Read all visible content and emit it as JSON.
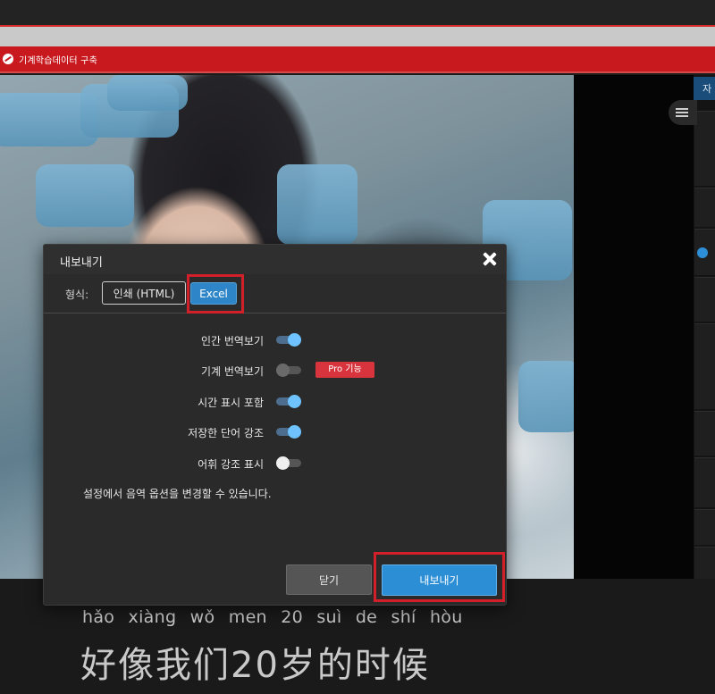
{
  "notice": {
    "text": "기계학습데이터 구축"
  },
  "side": {
    "tab_label": "자"
  },
  "subtitle": {
    "pinyin": "hǎo xiàng wǒ men 20 suì de shí hòu",
    "hanzi": "好像我们20岁的时候"
  },
  "dialog": {
    "title": "내보내기",
    "format_label": "형식:",
    "formats": [
      {
        "label": "인쇄 (HTML)",
        "selected": false
      },
      {
        "label": "Excel",
        "selected": true
      }
    ],
    "options": [
      {
        "label": "인간 번역보기",
        "enabled": true
      },
      {
        "label": "기계 번역보기",
        "enabled": false,
        "badge": "Pro 기능"
      },
      {
        "label": "시간 표시 포함",
        "enabled": true
      },
      {
        "label": "저장한 단어 강조",
        "enabled": true
      },
      {
        "label": "어휘 강조 표시",
        "enabled": false
      }
    ],
    "note": "설정에서 음역 옵션을 변경할 수 있습니다.",
    "close_label": "닫기",
    "export_label": "내보내기"
  },
  "colors": {
    "accent": "#2c8fd6",
    "highlight_frame": "#d1202a",
    "notice_bar": "#c8191f",
    "pro_badge": "#d8343d"
  }
}
